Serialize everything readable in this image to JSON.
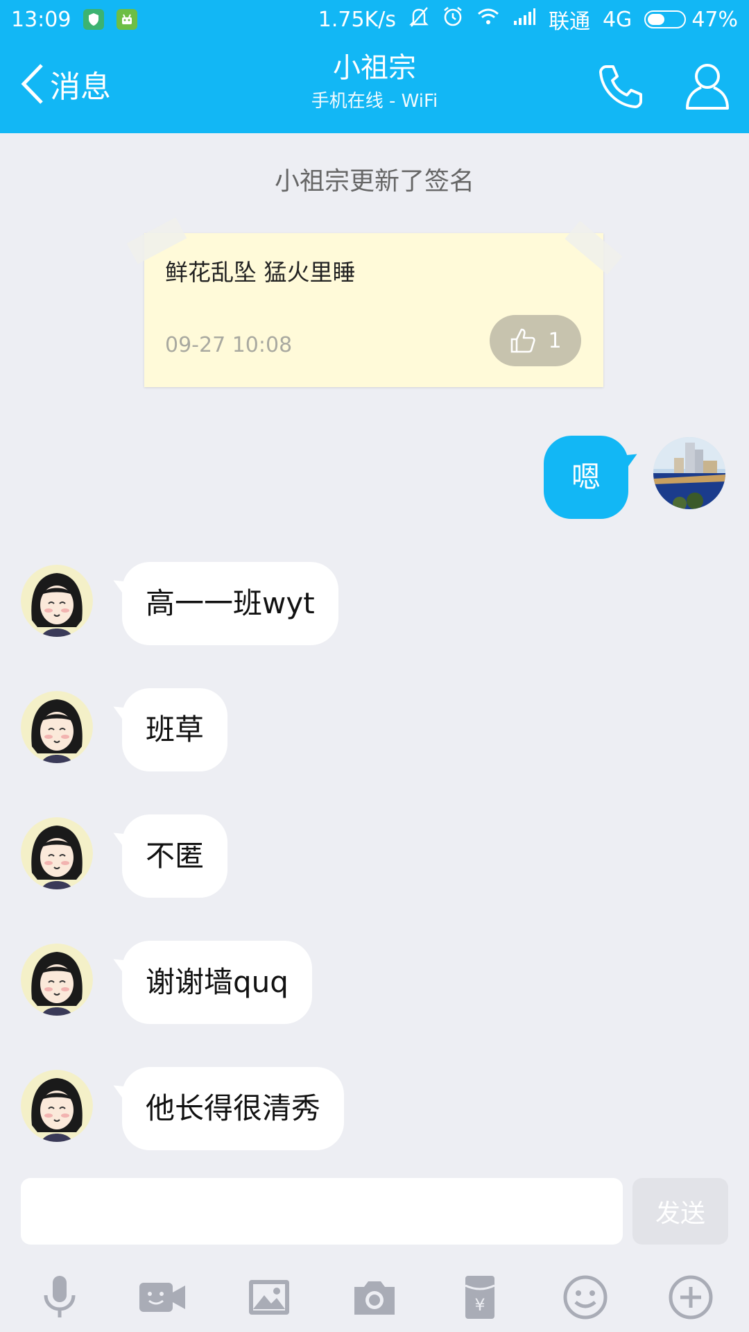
{
  "status_bar": {
    "time": "13:09",
    "net_speed": "1.75K/s",
    "carrier": "联通",
    "network": "4G",
    "battery": "47%",
    "battery_level": 0.47,
    "icons": [
      "shield-badge-icon",
      "android-badge-icon",
      "mute-icon",
      "alarm-icon",
      "wifi-icon",
      "signal-icon"
    ]
  },
  "header": {
    "back_label": "消息",
    "title": "小祖宗",
    "subtitle": "手机在线 - WiFi",
    "accent_color": "#12B7F5"
  },
  "chat": {
    "system_note": "小祖宗更新了签名",
    "signature_card": {
      "text": "鲜花乱坠 猛火里睡",
      "time": "09-27 10:08",
      "likes": "1"
    },
    "messages": [
      {
        "direction": "out",
        "text": "嗯"
      },
      {
        "direction": "in",
        "text": "高一一班wyt"
      },
      {
        "direction": "in",
        "text": "班草"
      },
      {
        "direction": "in",
        "text": "不匿"
      },
      {
        "direction": "in",
        "text": "谢谢墙quq"
      },
      {
        "direction": "in",
        "text": "他长得很清秀"
      }
    ]
  },
  "input": {
    "value": "",
    "send_label": "发送"
  },
  "toolbar": {
    "icons": [
      "microphone-icon",
      "video-chat-icon",
      "image-icon",
      "camera-icon",
      "red-packet-icon",
      "emoji-icon",
      "plus-icon"
    ]
  }
}
